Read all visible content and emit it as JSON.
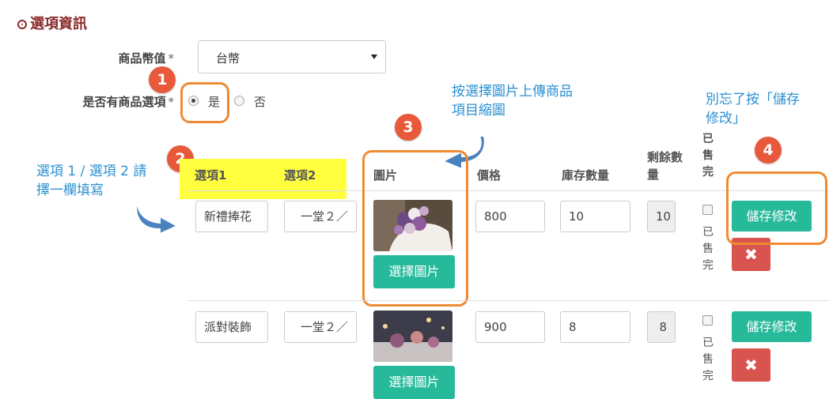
{
  "section": {
    "title": "選項資訊"
  },
  "form": {
    "currency_label": "商品幣值",
    "currency_value": "台幣",
    "has_options_label": "是否有商品選項",
    "required_mark": "*",
    "option_yes": "是",
    "option_no": "否"
  },
  "annotations": {
    "badge1": "1",
    "badge2": "2",
    "badge3": "3",
    "badge4": "4",
    "note2": "選項 1 / 選項 2 請\n擇一欄填寫",
    "note3": "按選擇圖片上傳商品\n項目縮圖",
    "note4": "別忘了按「儲存\n修改」",
    "accent_color": "#f08a32",
    "note_color": "#2a8fd1"
  },
  "table": {
    "headers": {
      "option1": "選項1",
      "option2": "選項2",
      "image": "圖片",
      "price": "價格",
      "stock": "庫存數量",
      "remaining": "剩餘數量",
      "sold_out": "已售完"
    },
    "rows": [
      {
        "option1": "新禮捧花",
        "option2": "一堂２／",
        "image_btn": "選擇圖片",
        "price": "800",
        "stock": "10",
        "remaining": "10",
        "sold_out_label": "已售完",
        "save_btn": "儲存修改",
        "delete_icon": "✖"
      },
      {
        "option1": "派對裝飾",
        "option2": "一堂２／",
        "image_btn": "選擇圖片",
        "price": "900",
        "stock": "8",
        "remaining": "8",
        "sold_out_label": "已售完",
        "save_btn": "儲存修改",
        "delete_icon": "✖"
      }
    ]
  },
  "colors": {
    "teal": "#26b99a",
    "red": "#d9534f",
    "title": "#8b2b2b"
  }
}
